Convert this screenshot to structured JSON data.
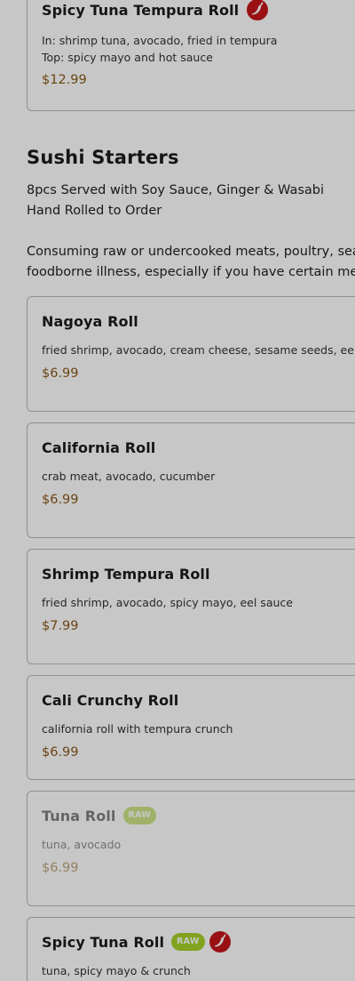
{
  "colors": {
    "price": "#8a5a1a",
    "raw_badge": "#a7d128",
    "spicy_icon": "#c4171c",
    "overlay": "rgba(0,0,0,0.22)"
  },
  "previous_item": {
    "name": "Spicy Tuna Tempura Roll",
    "desc_line1": "In: shrimp tuna, avocado, fried in tempura",
    "desc_line2": "Top: spicy mayo and hot sauce",
    "price": "$12.99",
    "icon": "spicy-pepper-icon"
  },
  "section": {
    "title": "Sushi Starters",
    "subtitle_line1": "8pcs Served with Soy Sauce, Ginger & Wasabi",
    "subtitle_line2": "Hand Rolled to Order",
    "notice_line1": "Consuming raw or undercooked meats, poultry, seafood",
    "notice_line2": "foodborne illness, especially if you have certain medical"
  },
  "items": [
    {
      "name": "Nagoya Roll",
      "desc": "fried shrimp, avocado, cream cheese, sesame seeds, eel sauce",
      "price": "$6.99"
    },
    {
      "name": "California Roll",
      "desc": "crab meat, avocado, cucumber",
      "price": "$6.99"
    },
    {
      "name": "Shrimp Tempura Roll",
      "desc": "fried shrimp, avocado, spicy mayo, eel sauce",
      "price": "$7.99"
    },
    {
      "name": "Cali Crunchy Roll",
      "desc": "california roll with tempura crunch",
      "price": "$6.99"
    },
    {
      "name": "Tuna Roll",
      "badge": "RAW",
      "desc": "tuna, avocado",
      "price": "$6.99",
      "unavailable": true
    },
    {
      "name": "Spicy Tuna Roll",
      "badge": "RAW",
      "icon": "spicy-pepper-icon",
      "desc": "tuna, spicy mayo & crunch"
    }
  ]
}
